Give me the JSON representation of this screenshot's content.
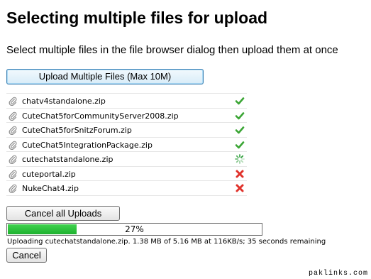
{
  "page": {
    "title": "Selecting multiple files for upload",
    "subtitle": "Select multiple files in the file browser dialog then upload them at once"
  },
  "upload_button": {
    "label": "Upload Multiple Files (Max 10M)"
  },
  "files": [
    {
      "name": "chatv4standalone.zip",
      "status": "done",
      "icon": "check-icon"
    },
    {
      "name": "CuteChat5forCommunityServer2008.zip",
      "status": "done",
      "icon": "check-icon"
    },
    {
      "name": "CuteChat5forSnitzForum.zip",
      "status": "done",
      "icon": "check-icon"
    },
    {
      "name": "CuteChat5IntegrationPackage.zip",
      "status": "done",
      "icon": "check-icon"
    },
    {
      "name": "cutechatstandalone.zip",
      "status": "uploading",
      "icon": "spinner-icon"
    },
    {
      "name": "cuteportal.zip",
      "status": "queued",
      "icon": "remove-icon"
    },
    {
      "name": "NukeChat4.zip",
      "status": "queued",
      "icon": "remove-icon"
    }
  ],
  "cancel_all_button": {
    "label": "Cancel all Uploads"
  },
  "progress": {
    "percent": 27,
    "label": "27%",
    "status_text": "Uploading cutechatstandalone.zip. 1.38 MB of 5.16 MB at 116KB/s; 35 seconds remaining"
  },
  "cancel_button": {
    "label": "Cancel"
  },
  "watermark": "paklinks.com",
  "colors": {
    "check": "#3aa534",
    "remove": "#e0322b",
    "spinner": "#2e9e3a",
    "progress_fill": "#1db12f"
  }
}
